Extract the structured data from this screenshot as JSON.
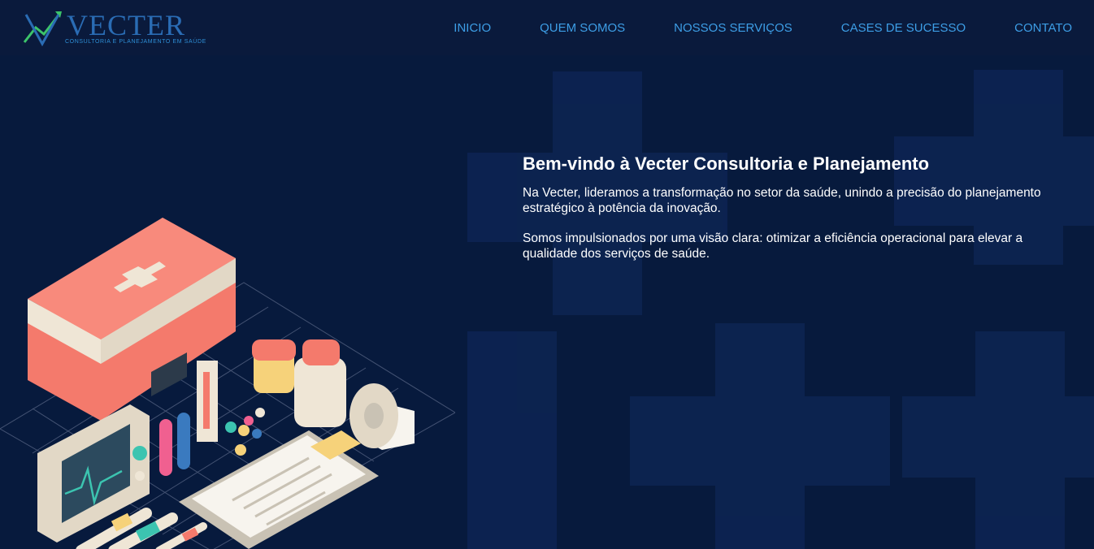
{
  "brand": {
    "name": "VECTER",
    "tagline": "CONSULTORIA E PLANEJAMENTO EM SAÚDE"
  },
  "nav": {
    "items": [
      {
        "label": "INICIO"
      },
      {
        "label": "QUEM SOMOS"
      },
      {
        "label": "NOSSOS SERVIÇOS"
      },
      {
        "label": "CASES DE SUCESSO"
      },
      {
        "label": "CONTATO"
      }
    ]
  },
  "hero": {
    "title": "Bem-vindo à Vecter Consultoria e Planejamento",
    "paragraph1": "Na Vecter, lideramos a transformação no setor da saúde, unindo a precisão do planejamento estratégico à potência da inovação.",
    "paragraph2": "Somos impulsionados por uma visão clara: otimizar a eficiência operacional para elevar a qualidade dos serviços de saúde."
  },
  "colors": {
    "background": "#071a3d",
    "nav_link": "#3d9ee6",
    "logo_blue": "#2a6cb4",
    "logo_green": "#3cc46a",
    "kit_red": "#f47a6c"
  }
}
